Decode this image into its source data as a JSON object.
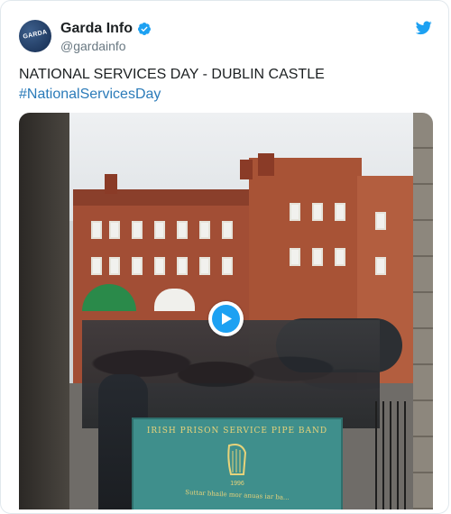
{
  "tweet": {
    "display_name": "Garda Info",
    "handle": "@gardainfo",
    "avatar_text": "GARDA",
    "text": "NATIONAL SERVICES DAY - DUBLIN CASTLE",
    "hashtag": "#NationalServicesDay"
  },
  "media": {
    "banner_title": "IRISH PRISON SERVICE PIPE BAND",
    "banner_year": "1996",
    "banner_motto": "Suttar bhaile mor anuas iar ba..."
  },
  "icons": {
    "verified": "verified-badge-icon",
    "bird": "twitter-bird-icon",
    "play": "play-icon"
  },
  "colors": {
    "link": "#2b7bb9",
    "twitter_blue": "#1da1f2",
    "text": "#1c2022",
    "muted": "#697882",
    "border": "#e1e8ed"
  }
}
